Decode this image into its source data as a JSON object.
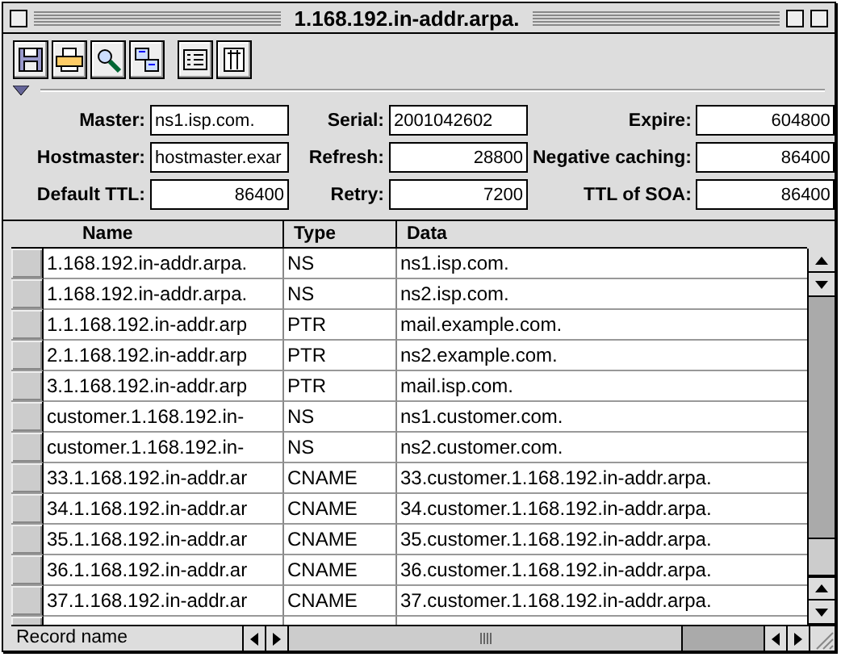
{
  "window": {
    "title": "1.168.192.in-addr.arpa."
  },
  "soa_fields": [
    {
      "label": "Master:",
      "value": "ns1.isp.com.",
      "kind": "text"
    },
    {
      "label": "Serial:",
      "value": "2001042602",
      "kind": "text"
    },
    {
      "label": "Expire:",
      "value": "604800",
      "kind": "number"
    },
    {
      "label": "Hostmaster:",
      "value": "hostmaster.exar",
      "kind": "text"
    },
    {
      "label": "Refresh:",
      "value": "28800",
      "kind": "number"
    },
    {
      "label": "Negative caching:",
      "value": "86400",
      "kind": "number"
    },
    {
      "label": "Default TTL:",
      "value": "86400",
      "kind": "number"
    },
    {
      "label": "Retry:",
      "value": "7200",
      "kind": "number"
    },
    {
      "label": "TTL of SOA:",
      "value": "86400",
      "kind": "number"
    }
  ],
  "table": {
    "columns": [
      "Name",
      "Type",
      "Data"
    ],
    "rows": [
      [
        "1.168.192.in-addr.arpa.",
        "NS",
        "ns1.isp.com."
      ],
      [
        "1.168.192.in-addr.arpa.",
        "NS",
        "ns2.isp.com."
      ],
      [
        "1.1.168.192.in-addr.arp",
        "PTR",
        "mail.example.com."
      ],
      [
        "2.1.168.192.in-addr.arp",
        "PTR",
        "ns2.example.com."
      ],
      [
        "3.1.168.192.in-addr.arp",
        "PTR",
        "mail.isp.com."
      ],
      [
        "customer.1.168.192.in-",
        "NS",
        "ns1.customer.com."
      ],
      [
        "customer.1.168.192.in-",
        "NS",
        "ns2.customer.com."
      ],
      [
        "33.1.168.192.in-addr.ar",
        "CNAME",
        "33.customer.1.168.192.in-addr.arpa."
      ],
      [
        "34.1.168.192.in-addr.ar",
        "CNAME",
        "34.customer.1.168.192.in-addr.arpa."
      ],
      [
        "35.1.168.192.in-addr.ar",
        "CNAME",
        "35.customer.1.168.192.in-addr.arpa."
      ],
      [
        "36.1.168.192.in-addr.ar",
        "CNAME",
        "36.customer.1.168.192.in-addr.arpa."
      ],
      [
        "37.1.168.192.in-addr.ar",
        "CNAME",
        "37.customer.1.168.192.in-addr.arpa."
      ]
    ]
  },
  "status_bar": {
    "label": "Record name"
  }
}
